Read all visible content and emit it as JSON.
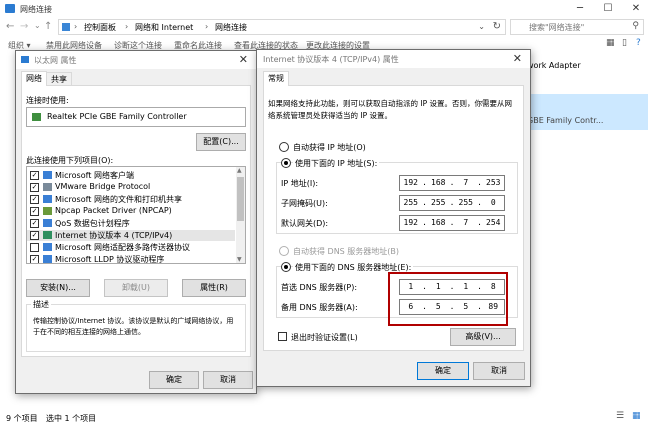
{
  "explorer": {
    "title": "网络连接",
    "breadcrumb": [
      "控制面板",
      "网络和 Internet",
      "网络连接"
    ],
    "search_placeholder": "搜索\"网络连接\"",
    "toolbar": [
      "组织 ▾",
      "禁用此网络设备",
      "诊断这个连接",
      "重命名此连接",
      "查看此连接的状态",
      "更改此连接的设置"
    ],
    "right_items": [
      "work Adapter",
      "GBE Family Contr..."
    ],
    "status_count": "9 个项目",
    "status_selected": "选中 1 个项目"
  },
  "eth_dialog": {
    "title": "以太网 属性",
    "tabs": [
      "网络",
      "共享"
    ],
    "connect_using_label": "连接时使用:",
    "adapter_name": "Realtek PCIe GBE Family Controller",
    "configure_button": "配置(C)...",
    "items_label": "此连接使用下列项目(O):",
    "items": [
      {
        "checked": true,
        "label": "Microsoft 网络客户端"
      },
      {
        "checked": true,
        "label": "VMware Bridge Protocol"
      },
      {
        "checked": true,
        "label": "Microsoft 网络的文件和打印机共享"
      },
      {
        "checked": true,
        "label": "Npcap Packet Driver (NPCAP)"
      },
      {
        "checked": true,
        "label": "QoS 数据包计划程序"
      },
      {
        "checked": true,
        "label": "Internet 协议版本 4 (TCP/IPv4)"
      },
      {
        "checked": false,
        "label": "Microsoft 网络适配器多路传送器协议"
      },
      {
        "checked": true,
        "label": "Microsoft LLDP 协议驱动程序"
      }
    ],
    "install_button": "安装(N)...",
    "uninstall_button": "卸载(U)",
    "properties_button": "属性(R)",
    "description_label": "描述",
    "description_text_1": "传输控制协议/Internet 协议。该协议是默认的广域网络协议，用",
    "description_text_2": "于在不同的相互连接的网络上通信。",
    "ok_button": "确定",
    "cancel_button": "取消"
  },
  "ipv4_dialog": {
    "title": "Internet 协议版本 4 (TCP/IPv4) 属性",
    "tab": "常规",
    "intro_1": "如果网络支持此功能，则可以获取自动指派的 IP 设置。否则，你需要从网",
    "intro_2": "络系统管理员处获得适当的 IP 设置。",
    "auto_ip_label": "自动获得 IP 地址(O)",
    "manual_ip_label": "使用下面的 IP 地址(S):",
    "ip_label": "IP 地址(I):",
    "ip_value": [
      "192",
      "168",
      "7",
      "253"
    ],
    "mask_label": "子网掩码(U):",
    "mask_value": [
      "255",
      "255",
      "255",
      "0"
    ],
    "gateway_label": "默认网关(D):",
    "gateway_value": [
      "192",
      "168",
      "7",
      "254"
    ],
    "auto_dns_label": "自动获得 DNS 服务器地址(B)",
    "manual_dns_label": "使用下面的 DNS 服务器地址(E):",
    "dns1_label": "首选 DNS 服务器(P):",
    "dns1_value": [
      "1",
      "1",
      "1",
      "8"
    ],
    "dns2_label": "备用 DNS 服务器(A):",
    "dns2_value": [
      "6",
      "5",
      "5",
      "89"
    ],
    "validate_label": "退出时验证设置(L)",
    "advanced_button": "高级(V)...",
    "ok_button": "确定",
    "cancel_button": "取消",
    "highlight_color": "#b00000"
  }
}
